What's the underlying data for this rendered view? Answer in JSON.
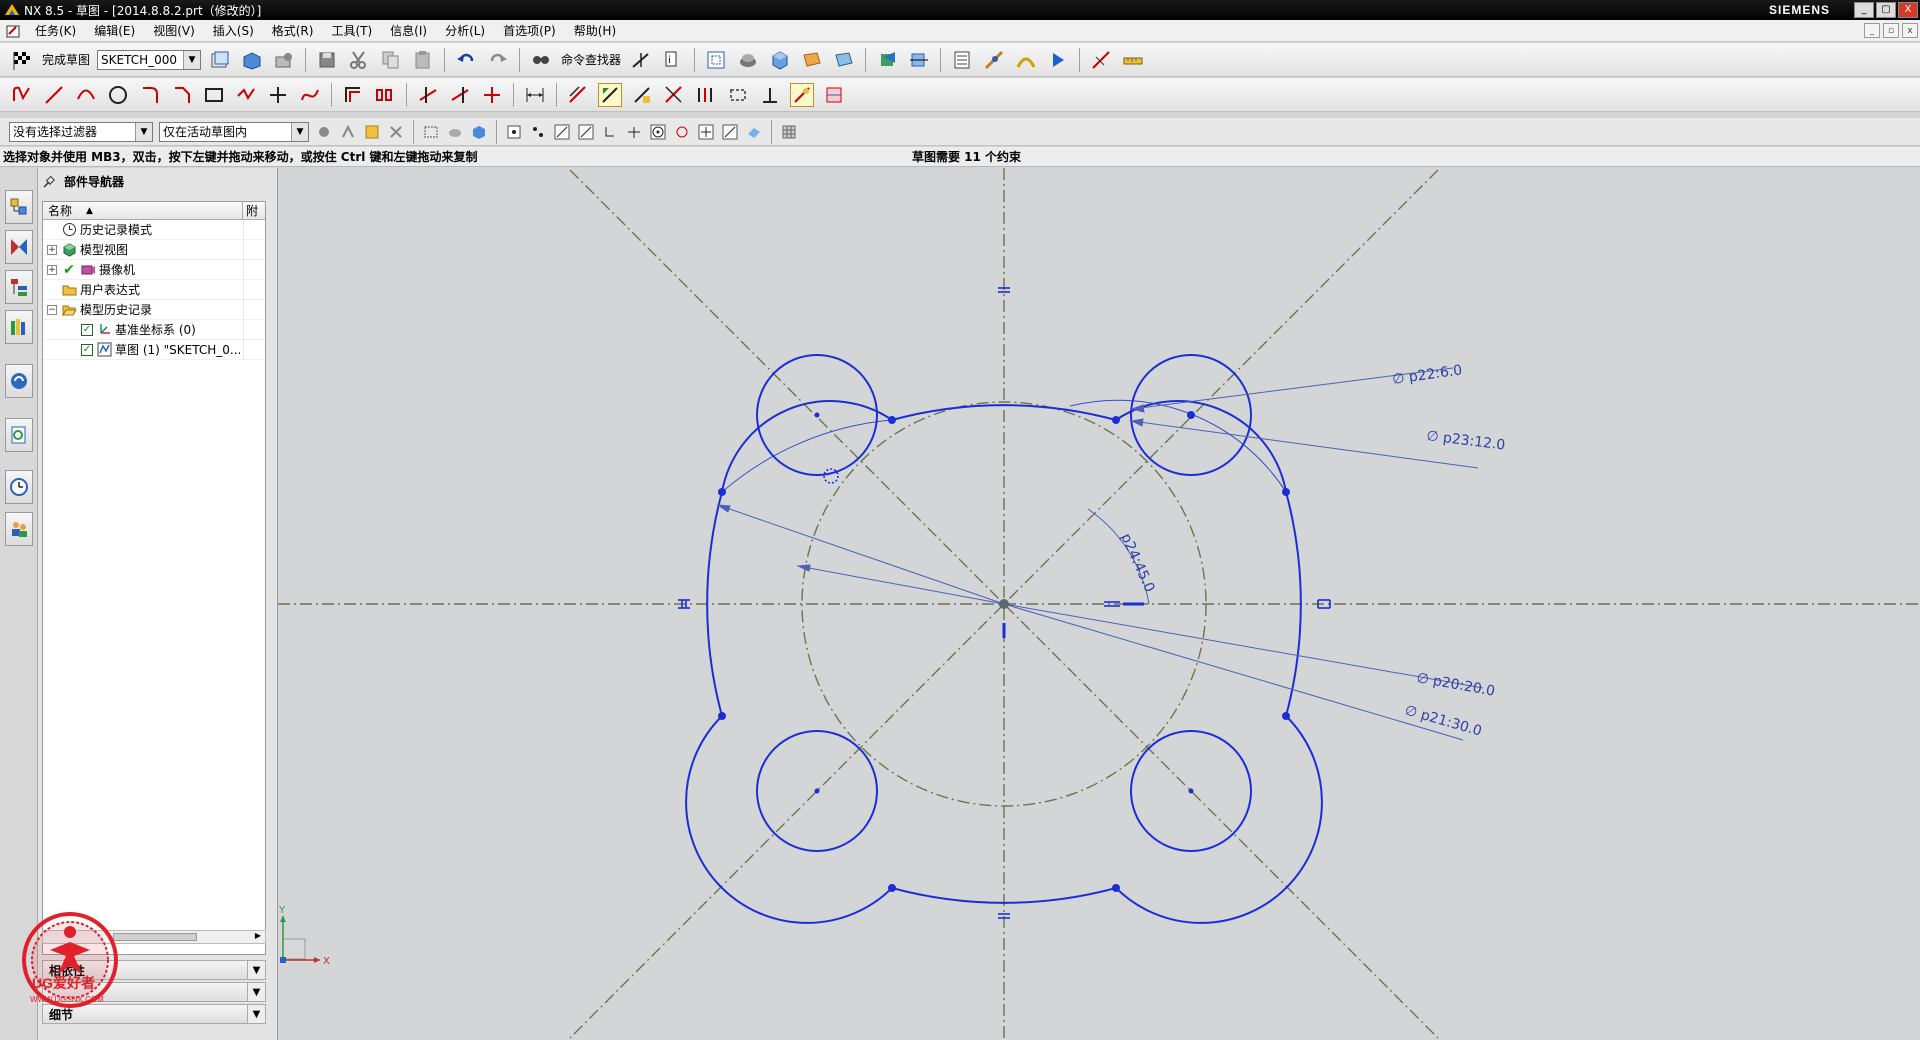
{
  "window": {
    "title": "NX 8.5 - 草图 - [2014.8.8.2.prt（修改的）]",
    "brand": "SIEMENS",
    "min": "_",
    "max": "▢",
    "close": "X"
  },
  "menu": {
    "items": [
      "任务(K)",
      "编辑(E)",
      "视图(V)",
      "插入(S)",
      "格式(R)",
      "工具(T)",
      "信息(I)",
      "分析(L)",
      "首选项(P)",
      "帮助(H)"
    ]
  },
  "toolbar": {
    "finish_sketch": "完成草图",
    "sketch_name": "SKETCH_000",
    "command_finder": "命令查找器"
  },
  "selection_bar": {
    "filter": "没有选择过滤器",
    "scope": "仅在活动草图内"
  },
  "status": {
    "prompt": "选择对象并使用 MB3，双击，按下左键并拖动来移动，或按住 Ctrl 键和左键拖动来复制",
    "message": "草图需要 11 个约束"
  },
  "navigator": {
    "title": "部件导航器",
    "col_name": "名称",
    "col_attached": "附",
    "nodes": [
      {
        "label": "历史记录模式",
        "icon": "clock-icon"
      },
      {
        "label": "模型视图",
        "icon": "model-views-icon"
      },
      {
        "label": "摄像机",
        "icon": "camera-icon"
      },
      {
        "label": "用户表达式",
        "icon": "folder-icon"
      },
      {
        "label": "模型历史记录",
        "icon": "folder-open-icon"
      },
      {
        "label": "基准坐标系 (0)",
        "icon": "datum-csys-icon"
      },
      {
        "label": "草图 (1) \"SKETCH_0...",
        "icon": "sketch-icon"
      }
    ],
    "panel_related": "相依性",
    "panel_details": "细节"
  },
  "dimensions": {
    "d1": "∅ p22:6.0",
    "d2": "∅ p23:12.0",
    "d3": "p24:45.0",
    "d4": "∅ p20:20.0",
    "d5": "∅ p21:30.0"
  },
  "triad": {
    "x": "X",
    "y": "Y"
  },
  "watermark": {
    "name": "UG爱好者",
    "url": "WWW.UGSNX.COM"
  },
  "colors": {
    "sketch_curve": "#1a2ed8",
    "dimension": "#4a62b8",
    "reference_line": "#6e7350",
    "background": "#d4d5d6"
  }
}
